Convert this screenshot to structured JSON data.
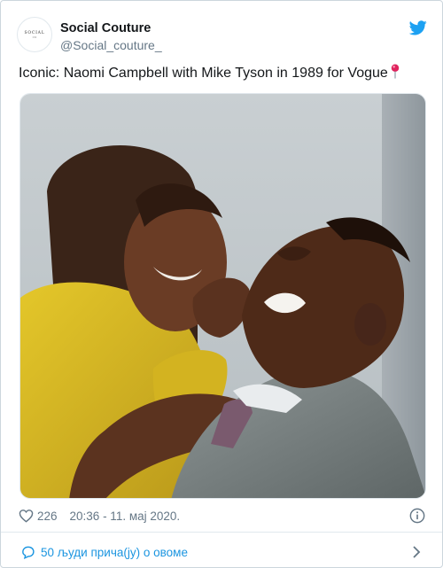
{
  "account": {
    "name": "Social Couture",
    "handle": "@Social_couture_",
    "avatar_text": "SOCIAL",
    "avatar_subtext": "CO"
  },
  "tweet": {
    "text": "Iconic: Naomi Campbell with Mike Tyson in 1989 for Vogue"
  },
  "meta": {
    "likes": "226",
    "timestamp": "20:36 - 11. мај 2020."
  },
  "conversation": {
    "label": "50 људи прича(ју) о овоме"
  },
  "colors": {
    "brand_blue": "#1da1f2",
    "link_blue": "#1b95e0",
    "secondary_text": "#657786",
    "pin_red": "#e0245e"
  },
  "icons": [
    "twitter-bird-icon",
    "pin-icon",
    "heart-icon",
    "info-icon",
    "speech-bubble-icon",
    "chevron-right-icon"
  ]
}
